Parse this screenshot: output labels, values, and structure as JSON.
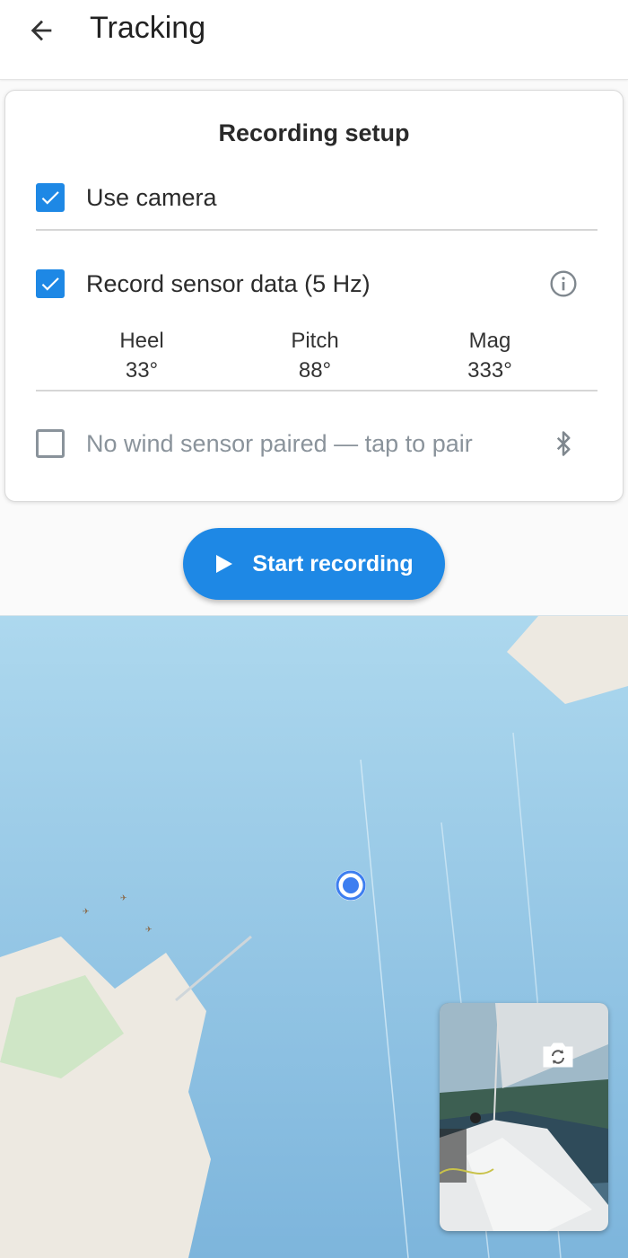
{
  "appbar": {
    "title": "Tracking",
    "back_icon": "arrow-left-icon"
  },
  "recording_setup": {
    "title": "Recording setup",
    "use_camera": {
      "label": "Use camera",
      "checked": true
    },
    "sensor_data": {
      "label": "Record sensor data (5 Hz)",
      "checked": true,
      "info_icon": "info-icon",
      "metrics": [
        {
          "name": "Heel",
          "value": "33°"
        },
        {
          "name": "Pitch",
          "value": "88°"
        },
        {
          "name": "Mag",
          "value": "333°"
        }
      ]
    },
    "wind_sensor": {
      "label": "No wind sensor paired — tap to pair",
      "checked": false,
      "icon": "bluetooth-icon"
    }
  },
  "start_button": {
    "label": "Start recording",
    "icon": "play-icon"
  },
  "map": {
    "location_marker": "current-location-marker",
    "camera_preview": {
      "switch_icon": "switch-camera-icon"
    }
  },
  "colors": {
    "accent": "#1e88e5",
    "water": "#8fc3e3",
    "land": "#ede9e1",
    "park": "#cfe6c6"
  }
}
